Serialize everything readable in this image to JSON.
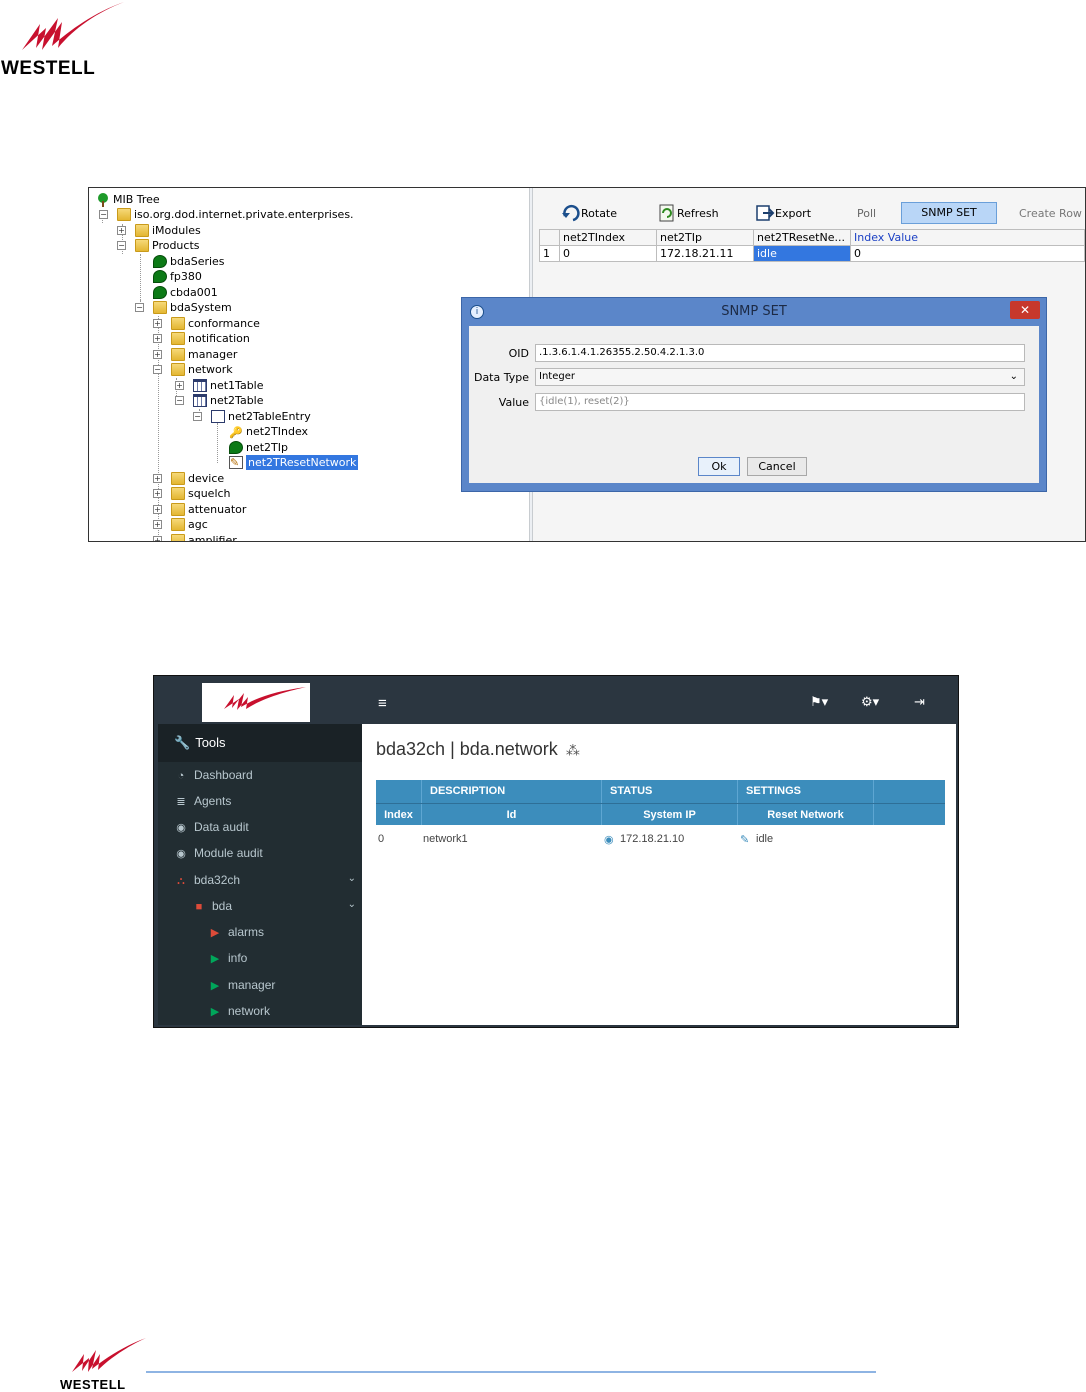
{
  "brand": {
    "name": "WESTELL",
    "color": "#c8102e"
  },
  "mib_tool": {
    "tree": {
      "title": "MIB Tree",
      "nodes": [
        {
          "label": "iso.org.dod.internet.private.enterprises.",
          "icon": "folder-icon"
        },
        {
          "label": "iModules",
          "icon": "folder-icon"
        },
        {
          "label": "Products",
          "icon": "folder-icon"
        },
        {
          "label": "bdaSeries",
          "icon": "leaf-icon"
        },
        {
          "label": "fp380",
          "icon": "leaf-icon"
        },
        {
          "label": "cbda001",
          "icon": "leaf-icon"
        },
        {
          "label": "bdaSystem",
          "icon": "folder-icon"
        },
        {
          "label": "conformance",
          "icon": "folder-icon"
        },
        {
          "label": "notification",
          "icon": "folder-icon"
        },
        {
          "label": "manager",
          "icon": "folder-icon"
        },
        {
          "label": "network",
          "icon": "folder-icon"
        },
        {
          "label": "net1Table",
          "icon": "table-icon"
        },
        {
          "label": "net2Table",
          "icon": "table-icon"
        },
        {
          "label": "net2TableEntry",
          "icon": "entry-icon"
        },
        {
          "label": "net2TIndex",
          "icon": "key-icon"
        },
        {
          "label": "net2TIp",
          "icon": "leaf-icon"
        },
        {
          "label": "net2TResetNetwork",
          "icon": "edit-icon"
        },
        {
          "label": "device",
          "icon": "folder-icon"
        },
        {
          "label": "squelch",
          "icon": "folder-icon"
        },
        {
          "label": "attenuator",
          "icon": "folder-icon"
        },
        {
          "label": "agc",
          "icon": "folder-icon"
        },
        {
          "label": "amplifier",
          "icon": "folder-icon"
        }
      ]
    },
    "toolbar": {
      "rotate": "Rotate",
      "refresh": "Refresh",
      "export": "Export",
      "poll": "Poll",
      "snmp_set": "SNMP SET",
      "create_row": "Create Row"
    },
    "grid": {
      "headers": [
        "net2TIndex",
        "net2TIp",
        "net2TResetNe...",
        "Index Value"
      ],
      "row": {
        "num": "1",
        "index": "0",
        "ip": "172.18.21.11",
        "reset": "idle",
        "index_value": "0"
      }
    },
    "dialog": {
      "title": "SNMP SET",
      "oid_label": "OID",
      "oid_value": ".1.3.6.1.4.1.26355.2.50.4.2.1.3.0",
      "datatype_label": "Data Type",
      "datatype_value": "Integer",
      "value_label": "Value",
      "value_placeholder": "{idle(1), reset(2)}",
      "ok": "Ok",
      "cancel": "Cancel",
      "close_glyph": "✕"
    }
  },
  "web_ui": {
    "sidebar": {
      "tools": "Tools",
      "items": [
        "Dashboard",
        "Agents",
        "Data audit",
        "Module audit",
        "bda32ch",
        "bda",
        "alarms",
        "info",
        "manager",
        "network"
      ]
    },
    "page_title": "bda32ch | bda.network",
    "table": {
      "group_headers": [
        "DESCRIPTION",
        "STATUS",
        "SETTINGS"
      ],
      "columns": [
        "Index",
        "Id",
        "System IP",
        "Reset Network"
      ],
      "row": {
        "index": "0",
        "id": "network1",
        "system_ip": "172.18.21.10",
        "reset": "idle"
      }
    },
    "colors": {
      "sidebar": "#222d32",
      "header": "#2b3640",
      "table_header": "#3c8dbc",
      "accent_red": "#dd4b39",
      "accent_green": "#00a65a"
    }
  }
}
